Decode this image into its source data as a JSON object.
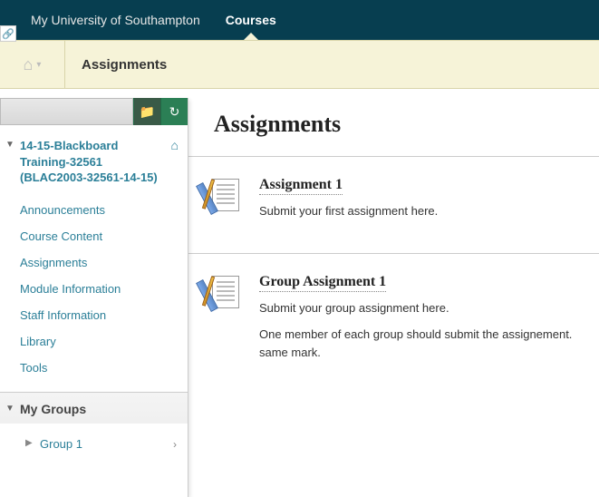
{
  "topbar": {
    "home_label": "My University of Southampton",
    "courses_label": "Courses"
  },
  "breadcrumb": {
    "title": "Assignments"
  },
  "sidebar": {
    "course_title": "14-15-Blackboard Training-32561 (BLAC2003-32561-14-15)",
    "items": [
      "Announcements",
      "Course Content",
      "Assignments",
      "Module Information",
      "Staff Information",
      "Library",
      "Tools"
    ],
    "groups_title": "My Groups",
    "groups_items": [
      "Group 1"
    ]
  },
  "content": {
    "heading": "Assignments",
    "items": [
      {
        "title": "Assignment 1",
        "desc": [
          "Submit your first assignment here."
        ]
      },
      {
        "title": "Group Assignment 1",
        "desc": [
          "Submit your group assignment here.",
          "One member of each group should submit the assignement. same mark."
        ]
      }
    ]
  }
}
